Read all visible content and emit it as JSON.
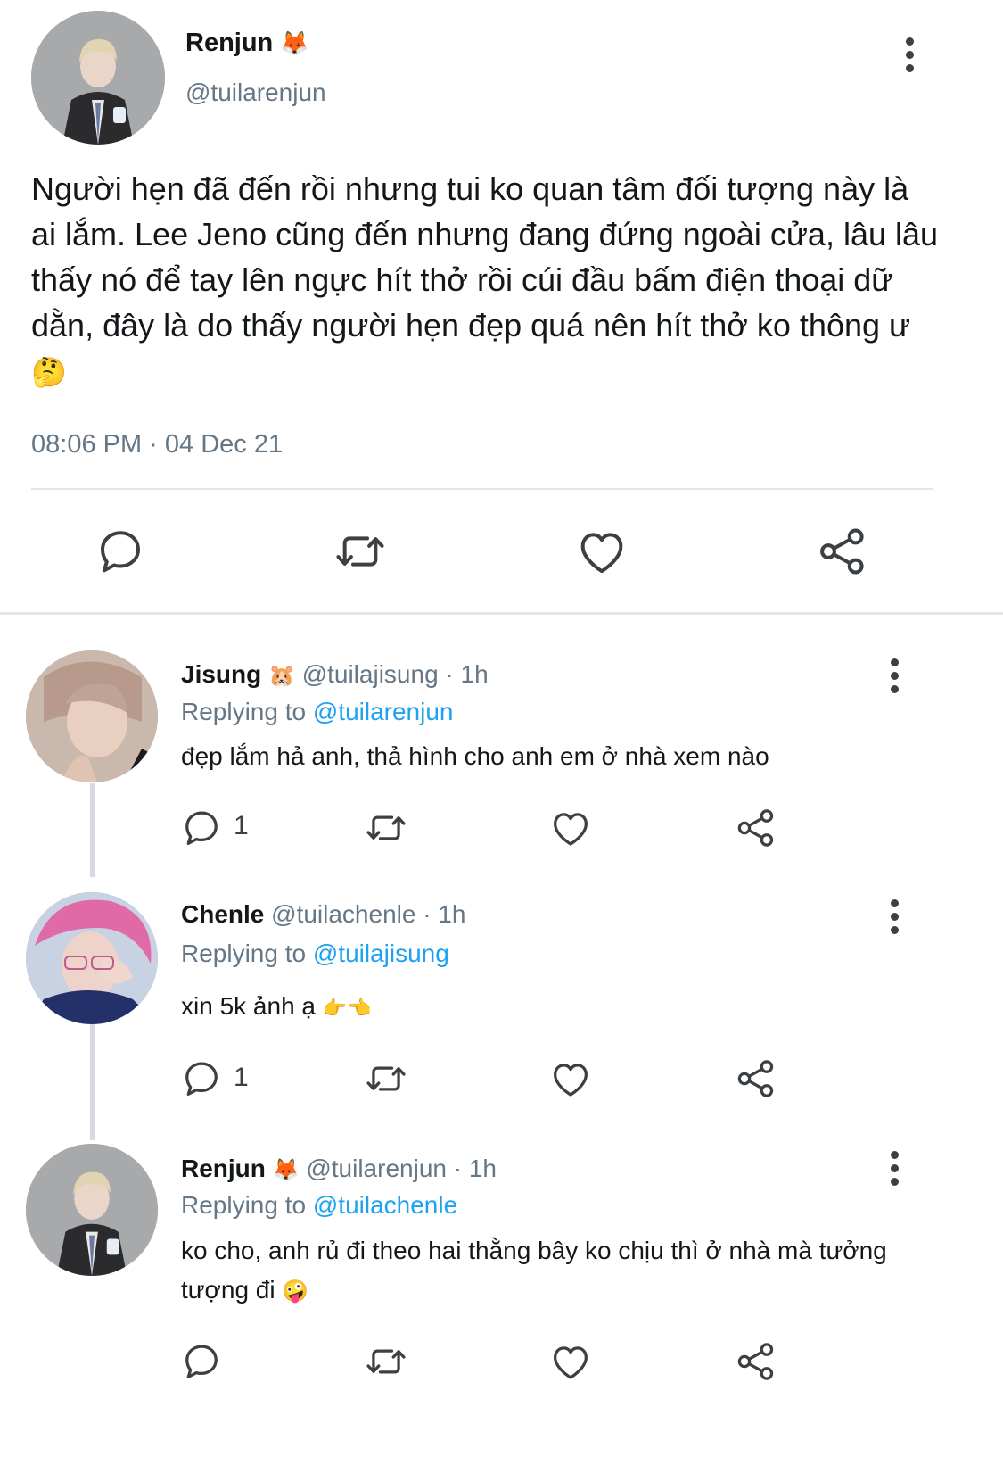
{
  "main_tweet": {
    "name": "Renjun",
    "name_emoji": "🦊",
    "handle": "@tuilarenjun",
    "text": "Người hẹn đã đến rồi nhưng tui ko quan tâm đối tượng này là ai lắm. Lee Jeno cũng đến nhưng đang đứng ngoài cửa, lâu lâu thấy nó để tay lên ngực hít thở rồi cúi đầu bấm điện thoại dữ dằn, đây là do thấy người hẹn đẹp quá nên hít thở ko thông ư",
    "text_emoji": "🤔",
    "timestamp": "08:06 PM · 04 Dec 21"
  },
  "replies": [
    {
      "name": "Jisung",
      "name_emoji": "🐹",
      "handle": "@tuilajisung",
      "time": "· 1h",
      "replying_label": "Replying to",
      "replying_to": "@tuilarenjun",
      "text": "đẹp lắm hả anh, thả hình cho anh em ở nhà xem nào",
      "text_emoji": "",
      "reply_count": "1"
    },
    {
      "name": "Chenle",
      "name_emoji": "",
      "handle": "@tuilachenle",
      "time": "· 1h",
      "replying_label": "Replying to",
      "replying_to": "@tuilajisung",
      "text": "xin 5k ảnh ạ",
      "text_emoji": "👉👈",
      "reply_count": "1"
    },
    {
      "name": "Renjun",
      "name_emoji": "🦊",
      "handle": "@tuilarenjun",
      "time": "· 1h",
      "replying_label": "Replying to",
      "replying_to": "@tuilachenle",
      "text": "ko cho, anh rủ đi theo hai thằng bây ko chịu thì ở nhà mà tưởng tượng đi",
      "text_emoji": "🤪",
      "reply_count": ""
    }
  ],
  "icons": {
    "reply": "speech-bubble-icon",
    "retweet": "retweet-icon",
    "like": "heart-icon",
    "share": "share-icon",
    "more": "more-vertical-icon"
  },
  "colors": {
    "text": "#14171a",
    "muted": "#657786",
    "mention": "#1da1f2",
    "divider": "#e1e8ed"
  }
}
